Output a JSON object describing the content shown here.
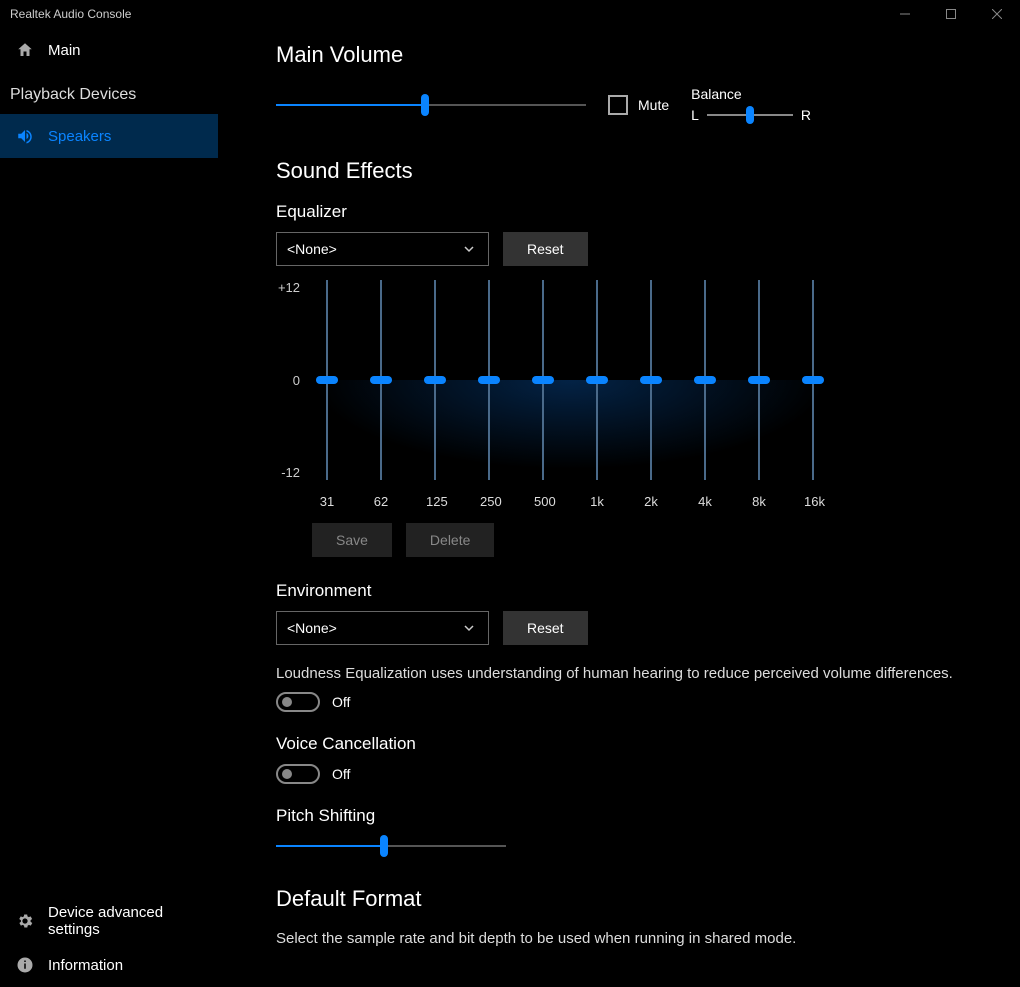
{
  "window": {
    "title": "Realtek Audio Console"
  },
  "sidebar": {
    "main_label": "Main",
    "playback_header": "Playback Devices",
    "speakers_label": "Speakers",
    "advanced_label": "Device advanced settings",
    "info_label": "Information"
  },
  "main_volume": {
    "title": "Main Volume",
    "value_pct": 48,
    "mute_label": "Mute",
    "mute_checked": false,
    "balance_label": "Balance",
    "balance_left": "L",
    "balance_right": "R",
    "balance_pct": 50
  },
  "sound_effects": {
    "title": "Sound Effects",
    "equalizer": {
      "label": "Equalizer",
      "preset": "<None>",
      "reset_label": "Reset",
      "save_label": "Save",
      "delete_label": "Delete",
      "y_top": "+12",
      "y_mid": "0",
      "y_bot": "-12",
      "bands": [
        {
          "freq": "31",
          "value": 0
        },
        {
          "freq": "62",
          "value": 0
        },
        {
          "freq": "125",
          "value": 0
        },
        {
          "freq": "250",
          "value": 0
        },
        {
          "freq": "500",
          "value": 0
        },
        {
          "freq": "1k",
          "value": 0
        },
        {
          "freq": "2k",
          "value": 0
        },
        {
          "freq": "4k",
          "value": 0
        },
        {
          "freq": "8k",
          "value": 0
        },
        {
          "freq": "16k",
          "value": 0
        }
      ]
    },
    "environment": {
      "label": "Environment",
      "preset": "<None>",
      "reset_label": "Reset"
    },
    "loudness": {
      "desc": "Loudness Equalization uses understanding of human hearing to reduce perceived volume differences.",
      "state_label": "Off",
      "on": false
    },
    "voice_cancellation": {
      "label": "Voice Cancellation",
      "state_label": "Off",
      "on": false
    },
    "pitch": {
      "label": "Pitch Shifting",
      "value_pct": 47
    }
  },
  "default_format": {
    "title": "Default Format",
    "desc": "Select the sample rate and bit depth to be used when running in shared mode."
  }
}
